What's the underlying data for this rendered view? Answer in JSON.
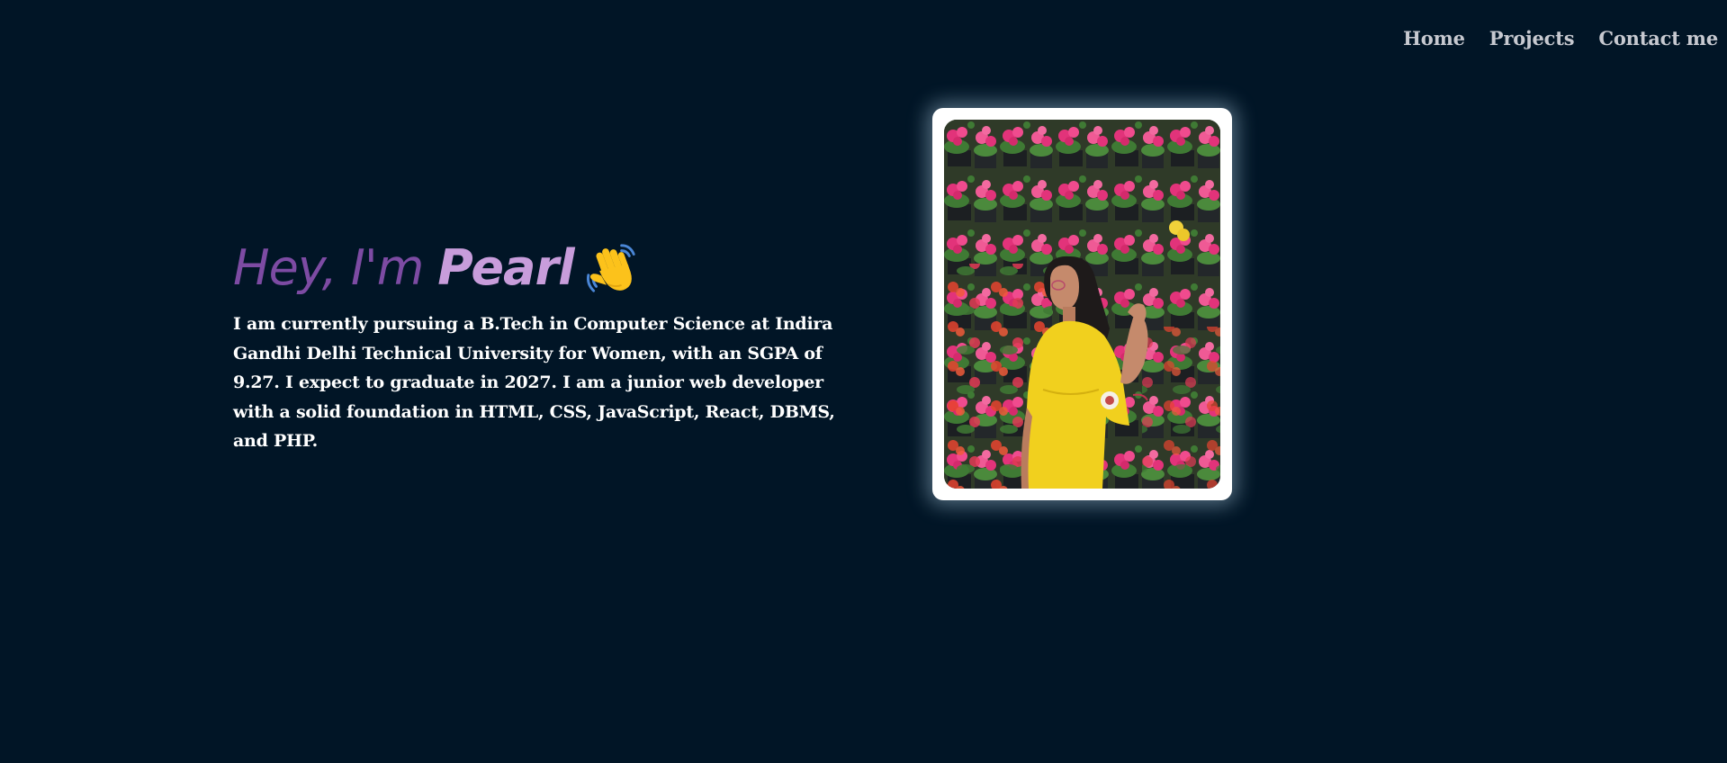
{
  "nav": {
    "items": [
      {
        "label": "Home"
      },
      {
        "label": "Projects"
      },
      {
        "label": "Contact me"
      }
    ]
  },
  "hero": {
    "greeting_prefix": "Hey, I'm",
    "name": "Pearl",
    "wave_icon": "waving-hand-icon",
    "bio": "I am currently pursuing a B.Tech in Computer Science at Indira Gandhi Delhi Technical University for Women, with an SGPA of 9.27. I expect to graduate in 2027. I am a junior web developer with a solid foundation in HTML, CSS, JavaScript, React, DBMS, and PHP."
  },
  "profile_photo": {
    "subject": "person in yellow dress in front of a wall of pink and red flowers"
  },
  "colors": {
    "background": "#011526",
    "greeting_accent": "#7d4ba3",
    "name_accent": "#c89ddb",
    "nav_text": "#c7c9d0"
  }
}
